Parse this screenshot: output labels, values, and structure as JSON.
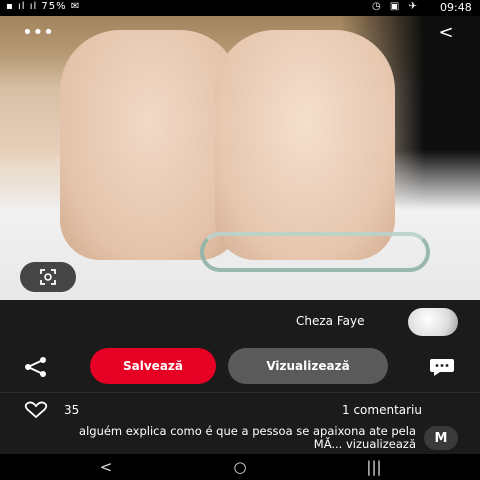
{
  "status_bar": {
    "time": "09:48",
    "system_icons": "◷ ▣ ✈",
    "signal_text": "▪ ıl ıl 75% ✉"
  },
  "pin": {
    "back_icon": "chevron-left-icon",
    "more_icon": "ellipsis-icon",
    "lens_icon": "visual-search-icon",
    "back_glyph": "<",
    "more_glyph": "•••"
  },
  "creator": {
    "name": "Cheza Faye"
  },
  "actions": {
    "visit_label": "Vizualizează",
    "save_label": "Salvează",
    "save_color": "#e60023"
  },
  "comments": {
    "count_label": "1 comentariu",
    "likes_count": "35",
    "items": [
      {
        "initial": "M",
        "text": "alguém explica como é que a pessoa se apaixona ate pela MĂ... vizualizează"
      }
    ]
  },
  "nav": {
    "back_glyph": "<",
    "home_glyph": "○",
    "recents_glyph": "|||"
  }
}
